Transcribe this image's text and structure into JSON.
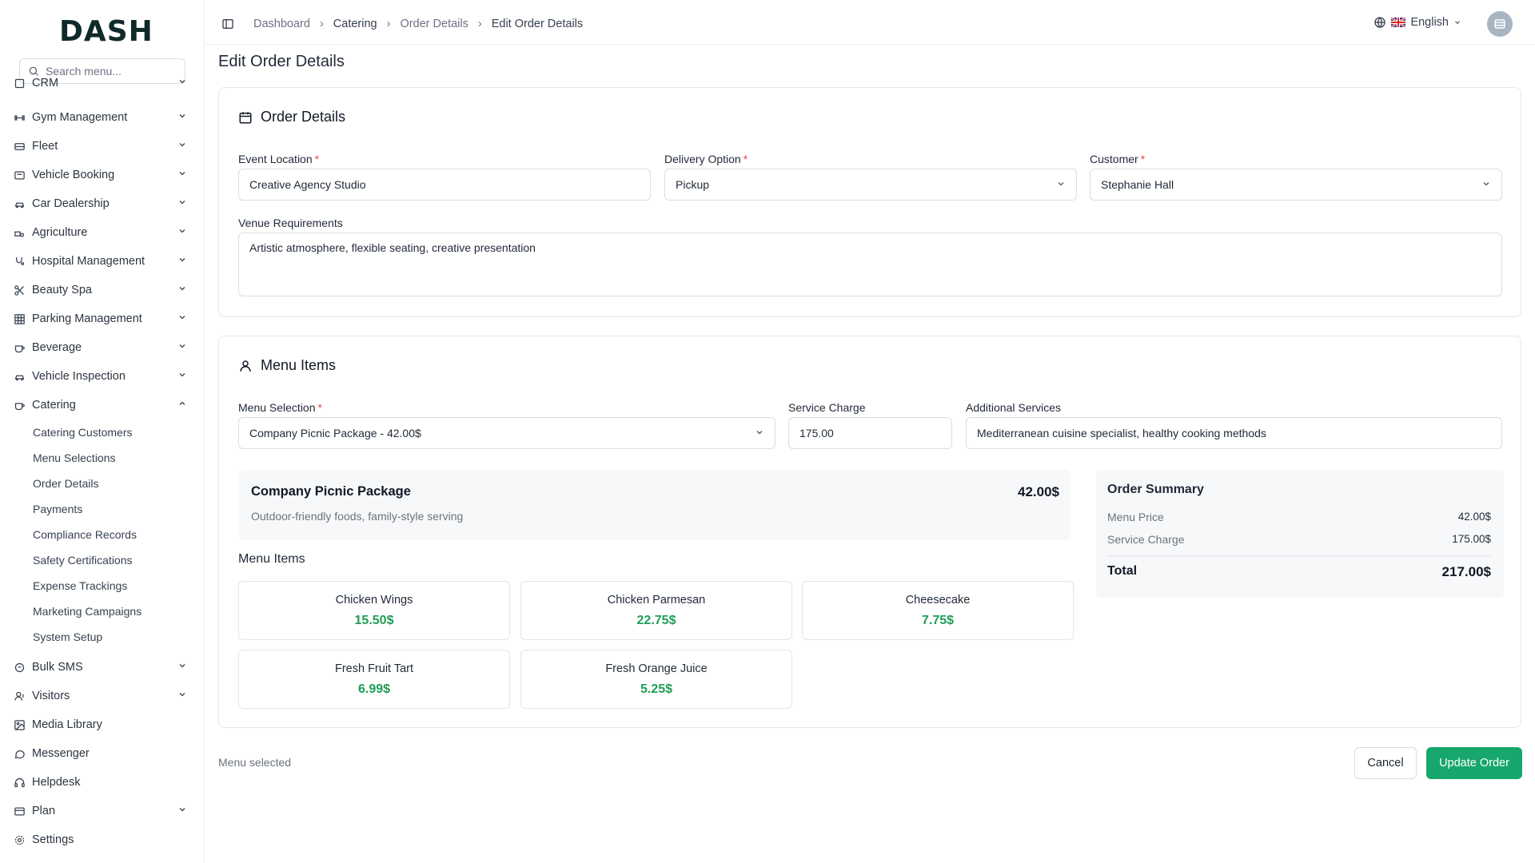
{
  "app": {
    "logo": "DASH"
  },
  "sidebar": {
    "search_placeholder": "Search menu...",
    "items": [
      {
        "label": "CRM",
        "icon": "crm-icon"
      },
      {
        "label": "Gym Management",
        "icon": "gym-icon"
      },
      {
        "label": "Fleet",
        "icon": "fleet-icon"
      },
      {
        "label": "Vehicle Booking",
        "icon": "vehicle-booking-icon"
      },
      {
        "label": "Car Dealership",
        "icon": "car-icon"
      },
      {
        "label": "Agriculture",
        "icon": "agriculture-icon"
      },
      {
        "label": "Hospital Management",
        "icon": "stethoscope-icon"
      },
      {
        "label": "Beauty Spa",
        "icon": "scissors-icon"
      },
      {
        "label": "Parking Management",
        "icon": "grid-icon"
      },
      {
        "label": "Beverage",
        "icon": "cup-icon"
      },
      {
        "label": "Vehicle Inspection",
        "icon": "car-icon"
      },
      {
        "label": "Catering",
        "icon": "cup-icon"
      },
      {
        "label": "Bulk SMS",
        "icon": "message-icon"
      },
      {
        "label": "Visitors",
        "icon": "visitors-icon"
      },
      {
        "label": "Media Library",
        "icon": "image-icon"
      },
      {
        "label": "Messenger",
        "icon": "chat-icon"
      },
      {
        "label": "Helpdesk",
        "icon": "headset-icon"
      },
      {
        "label": "Plan",
        "icon": "card-icon"
      },
      {
        "label": "Settings",
        "icon": "gear-icon"
      }
    ],
    "catering_sub": [
      "Catering Customers",
      "Menu Selections",
      "Order Details",
      "Payments",
      "Compliance Records",
      "Safety Certifications",
      "Expense Trackings",
      "Marketing Campaigns",
      "System Setup"
    ]
  },
  "topbar": {
    "breadcrumbs": [
      "Dashboard",
      "Catering",
      "Order Details",
      "Edit Order Details"
    ],
    "language": "English"
  },
  "page": {
    "title": "Edit Order Details"
  },
  "order_details": {
    "heading": "Order Details",
    "event_location_label": "Event Location",
    "event_location_value": "Creative Agency Studio",
    "delivery_option_label": "Delivery Option",
    "delivery_option_value": "Pickup",
    "customer_label": "Customer",
    "customer_value": "Stephanie Hall",
    "venue_label": "Venue Requirements",
    "venue_value": "Artistic atmosphere, flexible seating, creative presentation"
  },
  "menu_items": {
    "heading": "Menu Items",
    "menu_selection_label": "Menu Selection",
    "menu_selection_value": "Company Picnic Package - 42.00$",
    "service_charge_label": "Service Charge",
    "service_charge_value": "175.00",
    "additional_services_label": "Additional Services",
    "additional_services_value": "Mediterranean cuisine specialist, healthy cooking methods",
    "package": {
      "name": "Company Picnic Package",
      "description": "Outdoor-friendly foods, family-style serving",
      "price": "42.00$"
    },
    "list_title": "Menu Items",
    "items": [
      {
        "name": "Chicken Wings",
        "price": "15.50$"
      },
      {
        "name": "Chicken Parmesan",
        "price": "22.75$"
      },
      {
        "name": "Cheesecake",
        "price": "7.75$"
      },
      {
        "name": "Fresh Fruit Tart",
        "price": "6.99$"
      },
      {
        "name": "Fresh Orange Juice",
        "price": "5.25$"
      }
    ],
    "summary": {
      "title": "Order Summary",
      "menu_price_label": "Menu Price",
      "menu_price_value": "42.00$",
      "service_charge_label": "Service Charge",
      "service_charge_value": "175.00$",
      "total_label": "Total",
      "total_value": "217.00$"
    }
  },
  "footer": {
    "status": "Menu selected",
    "cancel_label": "Cancel",
    "update_label": "Update Order"
  },
  "colors": {
    "accent": "#17a66b",
    "price_green": "#1f9d55",
    "required": "#ef4444"
  }
}
